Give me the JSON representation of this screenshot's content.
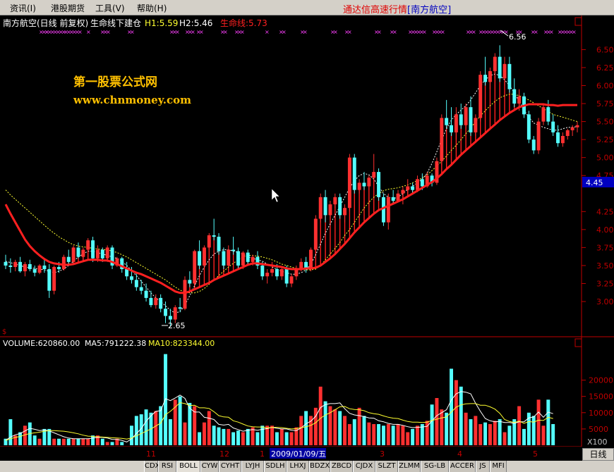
{
  "menu": [
    {
      "label": "资讯(I)"
    },
    {
      "label": "港股期货"
    },
    {
      "label": "工具(V)"
    },
    {
      "label": "帮助(H)"
    }
  ],
  "app_title": "通达信高速行情",
  "stock_tag": "[南方航空]",
  "header": {
    "stock": "南方航空(日线 前复权)",
    "indicator": "生命线下建仓",
    "h1_label": "H1:5.59",
    "h2_label": "H2:5.46",
    "life_label": "生命线:5.73"
  },
  "watermark": {
    "line1": "第一股票公式网",
    "line2": "www.chnmoney.com"
  },
  "price_axis": [
    "6.50",
    "6.25",
    "6.00",
    "5.75",
    "5.50",
    "5.25",
    "5.00",
    "4.75",
    "4.25",
    "4.00",
    "3.75",
    "3.50",
    "3.25",
    "3.00"
  ],
  "current_price": "4.45",
  "high_label": "6.56",
  "low_label": "2.65",
  "volume_header": {
    "vol": "VOLUME:620860.00",
    "ma5": "MA5:791222.38",
    "ma10": "MA10:823344.00"
  },
  "volume_axis": [
    "20000",
    "15000",
    "10000",
    "5000"
  ],
  "volume_unit": "X100",
  "date_axis": {
    "m11": "11",
    "m12": "12",
    "m1": "1",
    "selected_date": "2009/01/09/五",
    "m3": "3",
    "m4": "4",
    "m5": "5"
  },
  "period_button": "日线",
  "indicator_tabs": [
    "CDX",
    "RSI",
    "BOLL",
    "CYW",
    "CYHT",
    "LYJH",
    "SDLH",
    "LHXJ",
    "BDZX",
    "ZBCD",
    "CJDX",
    "SLZT",
    "ZLMM",
    "SG-LB",
    "ACCER",
    "JS",
    "MFI"
  ],
  "colors": {
    "up": "#ff3030",
    "down": "#54ffff",
    "lifeline": "#ff2020",
    "ma_white": "#ffffff",
    "ma_yellow": "#ffff30",
    "signal": "#ff40ff",
    "watermark": "#ffc000",
    "axis": "#c00000"
  },
  "chart_data": {
    "type": "candlestick",
    "y_range": [
      2.55,
      6.68
    ],
    "ohlc": [
      [
        3.55,
        3.65,
        3.45,
        3.5
      ],
      [
        3.5,
        3.6,
        3.4,
        3.48
      ],
      [
        3.48,
        3.58,
        3.42,
        3.55
      ],
      [
        3.55,
        3.62,
        3.4,
        3.42
      ],
      [
        3.42,
        3.55,
        3.35,
        3.52
      ],
      [
        3.52,
        3.58,
        3.42,
        3.45
      ],
      [
        3.45,
        3.5,
        3.35,
        3.4
      ],
      [
        3.4,
        3.52,
        3.38,
        3.5
      ],
      [
        3.5,
        3.6,
        3.4,
        3.45
      ],
      [
        3.45,
        3.52,
        3.05,
        3.15
      ],
      [
        3.15,
        3.5,
        3.1,
        3.48
      ],
      [
        3.48,
        3.55,
        3.4,
        3.45
      ],
      [
        3.45,
        3.65,
        3.43,
        3.62
      ],
      [
        3.62,
        3.72,
        3.52,
        3.55
      ],
      [
        3.55,
        3.78,
        3.52,
        3.75
      ],
      [
        3.75,
        3.82,
        3.6,
        3.62
      ],
      [
        3.62,
        3.75,
        3.55,
        3.72
      ],
      [
        3.72,
        3.88,
        3.6,
        3.85
      ],
      [
        3.85,
        3.9,
        3.55,
        3.6
      ],
      [
        3.6,
        3.78,
        3.55,
        3.72
      ],
      [
        3.72,
        3.75,
        3.55,
        3.6
      ],
      [
        3.6,
        3.78,
        3.55,
        3.75
      ],
      [
        3.75,
        3.78,
        3.45,
        3.5
      ],
      [
        3.5,
        3.62,
        3.48,
        3.6
      ],
      [
        3.6,
        3.62,
        3.4,
        3.45
      ],
      [
        3.45,
        3.55,
        3.3,
        3.35
      ],
      [
        3.35,
        3.48,
        3.25,
        3.3
      ],
      [
        3.3,
        3.4,
        3.15,
        3.2
      ],
      [
        3.2,
        3.3,
        3.1,
        3.15
      ],
      [
        3.15,
        3.25,
        3.0,
        3.05
      ],
      [
        3.05,
        3.15,
        2.92,
        2.95
      ],
      [
        2.95,
        3.1,
        2.9,
        3.05
      ],
      [
        3.05,
        3.1,
        2.85,
        2.9
      ],
      [
        2.9,
        3.0,
        2.7,
        2.8
      ],
      [
        2.8,
        2.9,
        2.65,
        2.75
      ],
      [
        2.75,
        2.95,
        2.7,
        2.92
      ],
      [
        2.92,
        3.05,
        2.85,
        2.9
      ],
      [
        2.9,
        3.35,
        2.88,
        3.3
      ],
      [
        3.3,
        3.42,
        3.2,
        3.25
      ],
      [
        3.25,
        3.72,
        3.22,
        3.7
      ],
      [
        3.7,
        3.85,
        3.45,
        3.5
      ],
      [
        3.5,
        3.78,
        3.48,
        3.75
      ],
      [
        3.75,
        3.95,
        3.72,
        3.92
      ],
      [
        3.92,
        4.15,
        3.85,
        3.9
      ],
      [
        3.9,
        3.95,
        3.65,
        3.7
      ],
      [
        3.7,
        3.75,
        3.45,
        3.5
      ],
      [
        3.5,
        3.78,
        3.48,
        3.72
      ],
      [
        3.72,
        3.9,
        3.65,
        3.7
      ],
      [
        3.7,
        3.75,
        3.45,
        3.5
      ],
      [
        3.5,
        3.7,
        3.45,
        3.68
      ],
      [
        3.68,
        3.72,
        3.5,
        3.55
      ],
      [
        3.55,
        3.65,
        3.5,
        3.62
      ],
      [
        3.62,
        3.7,
        3.45,
        3.5
      ],
      [
        3.5,
        3.55,
        3.3,
        3.35
      ],
      [
        3.35,
        3.45,
        3.25,
        3.4
      ],
      [
        3.4,
        3.55,
        3.35,
        3.45
      ],
      [
        3.45,
        3.52,
        3.3,
        3.35
      ],
      [
        3.35,
        3.48,
        3.3,
        3.45
      ],
      [
        3.45,
        3.5,
        3.2,
        3.25
      ],
      [
        3.25,
        3.38,
        3.2,
        3.35
      ],
      [
        3.35,
        3.5,
        3.3,
        3.45
      ],
      [
        3.45,
        3.6,
        3.42,
        3.55
      ],
      [
        3.55,
        3.62,
        3.4,
        3.45
      ],
      [
        3.45,
        3.75,
        3.42,
        3.72
      ],
      [
        3.72,
        4.2,
        3.7,
        4.15
      ],
      [
        4.15,
        4.5,
        4.1,
        4.45
      ],
      [
        4.45,
        4.55,
        4.1,
        4.2
      ],
      [
        4.2,
        4.4,
        4.15,
        4.35
      ],
      [
        4.35,
        4.5,
        4.3,
        4.45
      ],
      [
        4.45,
        4.5,
        4.15,
        4.2
      ],
      [
        4.2,
        4.35,
        4.1,
        4.3
      ],
      [
        4.3,
        5.05,
        4.25,
        5.0
      ],
      [
        5.0,
        5.05,
        4.5,
        4.55
      ],
      [
        4.55,
        4.7,
        4.5,
        4.65
      ],
      [
        4.65,
        4.8,
        4.55,
        4.6
      ],
      [
        4.6,
        4.75,
        4.55,
        4.72
      ],
      [
        4.72,
        5.05,
        4.7,
        4.8
      ],
      [
        4.8,
        4.85,
        4.4,
        4.45
      ],
      [
        4.45,
        4.5,
        4.05,
        4.1
      ],
      [
        4.1,
        4.5,
        4.0,
        4.45
      ],
      [
        4.45,
        4.55,
        4.35,
        4.4
      ],
      [
        4.4,
        4.55,
        4.38,
        4.5
      ],
      [
        4.5,
        4.6,
        4.35,
        4.55
      ],
      [
        4.55,
        4.7,
        4.5,
        4.6
      ],
      [
        4.6,
        4.65,
        4.5,
        4.55
      ],
      [
        4.55,
        4.75,
        4.52,
        4.7
      ],
      [
        4.7,
        4.78,
        4.55,
        4.6
      ],
      [
        4.6,
        4.8,
        4.58,
        4.75
      ],
      [
        4.75,
        4.78,
        4.6,
        4.65
      ],
      [
        4.65,
        5.0,
        4.62,
        4.95
      ],
      [
        4.95,
        5.6,
        4.9,
        5.55
      ],
      [
        5.55,
        5.8,
        5.4,
        5.45
      ],
      [
        5.45,
        5.7,
        5.3,
        5.35
      ],
      [
        5.35,
        5.7,
        5.25,
        5.6
      ],
      [
        5.6,
        5.75,
        5.4,
        5.45
      ],
      [
        5.45,
        5.75,
        5.4,
        5.7
      ],
      [
        5.7,
        5.85,
        5.3,
        5.35
      ],
      [
        5.35,
        5.6,
        5.3,
        5.55
      ],
      [
        5.55,
        6.2,
        5.5,
        6.15
      ],
      [
        6.15,
        6.4,
        6.0,
        6.05
      ],
      [
        6.05,
        6.25,
        5.95,
        6.2
      ],
      [
        6.2,
        6.45,
        6.1,
        6.4
      ],
      [
        6.4,
        6.56,
        6.05,
        6.1
      ],
      [
        6.1,
        6.4,
        6.0,
        6.3
      ],
      [
        6.3,
        6.4,
        5.9,
        5.95
      ],
      [
        5.95,
        6.1,
        5.7,
        5.75
      ],
      [
        5.75,
        5.95,
        5.65,
        5.85
      ],
      [
        5.85,
        5.9,
        5.55,
        5.6
      ],
      [
        5.6,
        5.65,
        5.2,
        5.25
      ],
      [
        5.25,
        5.3,
        5.05,
        5.1
      ],
      [
        5.1,
        5.55,
        5.05,
        5.5
      ],
      [
        5.5,
        5.75,
        5.45,
        5.7
      ],
      [
        5.7,
        5.8,
        5.45,
        5.5
      ],
      [
        5.5,
        5.6,
        5.3,
        5.35
      ],
      [
        5.35,
        5.45,
        5.15,
        5.2
      ],
      [
        5.2,
        5.35,
        5.15,
        5.3
      ],
      [
        5.3,
        5.4,
        5.25,
        5.38
      ],
      [
        5.38,
        5.45,
        5.3,
        5.42
      ],
      [
        5.42,
        5.5,
        5.35,
        5.45
      ]
    ],
    "volume": [
      2000,
      8000,
      3000,
      4000,
      6000,
      7000,
      3000,
      2000,
      5000,
      5000,
      2000,
      2000,
      2000,
      2000,
      2000,
      2000,
      2000,
      2000,
      3000,
      3000,
      2000,
      1000,
      1000,
      2000,
      1000,
      0,
      6000,
      9000,
      9500,
      11000,
      10000,
      10500,
      12000,
      28000,
      8000,
      14000,
      15000,
      7000,
      13000,
      12000,
      4000,
      7000,
      10500,
      6000,
      5500,
      5000,
      5000,
      4000,
      4500,
      4000,
      5000,
      5500,
      4000,
      6000,
      6000,
      6000,
      4000,
      5000,
      4000,
      4000,
      5500,
      9000,
      10500,
      9000,
      11500,
      18000,
      13500,
      12000,
      11000,
      10500,
      9000,
      6500,
      8000,
      11500,
      9000,
      7000,
      6500,
      6500,
      6000,
      6500,
      6000,
      6500,
      6000,
      4000,
      5000,
      6000,
      6500,
      7500,
      12500,
      14500,
      11000,
      10000,
      23500,
      20000,
      18000,
      10000,
      8000,
      9000,
      6500,
      7000,
      6500,
      7500,
      8000,
      4000,
      6000,
      8000,
      12000,
      5000,
      10000,
      9000,
      14000,
      6000,
      14000,
      6500
    ],
    "lifeline": [
      4.35,
      4.22,
      4.1,
      3.98,
      3.86,
      3.77,
      3.7,
      3.64,
      3.59,
      3.55,
      3.53,
      3.52,
      3.51,
      3.51,
      3.52,
      3.54,
      3.56,
      3.58,
      3.58,
      3.58,
      3.57,
      3.57,
      3.55,
      3.52,
      3.49,
      3.46,
      3.43,
      3.4,
      3.38,
      3.35,
      3.32,
      3.29,
      3.26,
      3.22,
      3.18,
      3.14,
      3.12,
      3.12,
      3.14,
      3.17,
      3.2,
      3.23,
      3.26,
      3.3,
      3.33,
      3.36,
      3.39,
      3.42,
      3.45,
      3.48,
      3.51,
      3.53,
      3.53,
      3.52,
      3.51,
      3.5,
      3.49,
      3.48,
      3.46,
      3.45,
      3.45,
      3.45,
      3.46,
      3.46,
      3.47,
      3.5,
      3.55,
      3.6,
      3.66,
      3.73,
      3.8,
      3.88,
      3.96,
      4.03,
      4.1,
      4.16,
      4.22,
      4.27,
      4.3,
      4.33,
      4.36,
      4.39,
      4.42,
      4.46,
      4.5,
      4.54,
      4.58,
      4.62,
      4.66,
      4.71,
      4.77,
      4.84,
      4.9,
      4.97,
      5.04,
      5.1,
      5.16,
      5.22,
      5.28,
      5.34,
      5.4,
      5.46,
      5.52,
      5.57,
      5.62,
      5.66,
      5.7,
      5.72,
      5.74,
      5.74,
      5.74,
      5.74,
      5.73,
      5.73,
      5.72,
      5.73,
      5.73,
      5.73,
      5.73
    ],
    "ma_yellow": [
      4.55,
      4.48,
      4.42,
      4.36,
      4.3,
      4.24,
      4.18,
      4.12,
      4.06,
      4.0,
      3.95,
      3.9,
      3.86,
      3.82,
      3.79,
      3.77,
      3.76,
      3.75,
      3.74,
      3.73,
      3.72,
      3.72,
      3.7,
      3.68,
      3.65,
      3.62,
      3.58,
      3.54,
      3.5,
      3.46,
      3.42,
      3.38,
      3.34,
      3.3,
      3.25,
      3.2,
      3.16,
      3.13,
      3.12,
      3.12,
      3.14,
      3.18,
      3.24,
      3.3,
      3.36,
      3.42,
      3.48,
      3.53,
      3.58,
      3.62,
      3.64,
      3.64,
      3.63,
      3.62,
      3.6,
      3.58,
      3.55,
      3.52,
      3.5,
      3.48,
      3.46,
      3.45,
      3.44,
      3.44,
      3.45,
      3.5,
      3.58,
      3.66,
      3.74,
      3.82,
      3.92,
      4.0,
      4.1,
      4.2,
      4.3,
      4.38,
      4.45,
      4.5,
      4.54,
      4.56,
      4.57,
      4.58,
      4.6,
      4.62,
      4.65,
      4.68,
      4.72,
      4.76,
      4.82,
      4.88,
      4.95,
      5.02,
      5.1,
      5.17,
      5.25,
      5.33,
      5.41,
      5.5,
      5.58,
      5.65,
      5.72,
      5.78,
      5.83,
      5.86,
      5.88,
      5.88,
      5.86,
      5.83,
      5.8,
      5.76,
      5.72,
      5.68,
      5.64,
      5.6,
      5.58,
      5.56,
      5.54,
      5.52,
      5.5
    ],
    "ma_white": [
      3.56,
      3.54,
      3.52,
      3.5,
      3.48,
      3.47,
      3.46,
      3.45,
      3.44,
      3.42,
      3.4,
      3.42,
      3.45,
      3.5,
      3.56,
      3.62,
      3.66,
      3.7,
      3.7,
      3.68,
      3.66,
      3.64,
      3.62,
      3.6,
      3.56,
      3.5,
      3.43,
      3.36,
      3.28,
      3.2,
      3.12,
      3.05,
      3.0,
      2.94,
      2.88,
      2.84,
      2.86,
      2.95,
      3.08,
      3.22,
      3.36,
      3.48,
      3.58,
      3.66,
      3.7,
      3.72,
      3.72,
      3.7,
      3.68,
      3.66,
      3.62,
      3.6,
      3.58,
      3.56,
      3.52,
      3.48,
      3.45,
      3.42,
      3.4,
      3.38,
      3.38,
      3.4,
      3.44,
      3.52,
      3.65,
      3.8,
      3.95,
      4.08,
      4.2,
      4.32,
      4.45,
      4.58,
      4.68,
      4.75,
      4.78,
      4.76,
      4.7,
      4.6,
      4.5,
      4.45,
      4.43,
      4.45,
      4.5,
      4.56,
      4.6,
      4.65,
      4.7,
      4.78,
      4.92,
      5.08,
      5.25,
      5.4,
      5.52,
      5.6,
      5.66,
      5.72,
      5.8,
      5.9,
      6.0,
      6.08,
      6.14,
      6.16,
      6.14,
      6.08,
      6.0,
      5.9,
      5.78,
      5.66,
      5.56,
      5.48,
      5.45,
      5.42,
      5.4,
      5.38,
      5.38,
      5.4,
      5.42,
      5.42,
      5.43
    ],
    "vol_ma5": [
      1500,
      2500,
      3200,
      3600,
      4400,
      5200,
      4900,
      4500,
      4700,
      4400,
      3800,
      3200,
      2600,
      2200,
      2000,
      2000,
      2000,
      2000,
      2200,
      2400,
      2400,
      2200,
      1800,
      1800,
      1500,
      1000,
      2000,
      3600,
      5100,
      7400,
      9000,
      10400,
      10600,
      14300,
      13700,
      14500,
      15400,
      14400,
      11400,
      10200,
      10200,
      8600,
      8300,
      7900,
      6400,
      6200,
      6400,
      5300,
      4800,
      4300,
      4600,
      4800,
      4600,
      4900,
      5100,
      5500,
      5200,
      5000,
      5000,
      4600,
      4500,
      5300,
      6600,
      7400,
      8900,
      11600,
      12500,
      12800,
      12800,
      13000,
      11200,
      9800,
      9300,
      9100,
      8800,
      8400,
      8300,
      7500,
      7200,
      6700,
      6400,
      6400,
      6100,
      5700,
      5400,
      5500,
      5600,
      5800,
      7500,
      9100,
      10000,
      10900,
      13900,
      15800,
      16500,
      16300,
      15800,
      12900,
      10400,
      8200,
      7500,
      7200,
      7300,
      7000,
      7000,
      6700,
      7200,
      7200,
      8400,
      8700,
      10200,
      8600,
      10200,
      9700
    ],
    "vol_ma10": [
      1500,
      2000,
      2400,
      2700,
      3200,
      3600,
      3800,
      4000,
      4300,
      4500,
      4500,
      4400,
      4300,
      4100,
      3800,
      3500,
      3100,
      2800,
      2700,
      2600,
      2500,
      2400,
      2300,
      2200,
      2100,
      1900,
      2200,
      2900,
      3600,
      4300,
      5000,
      5900,
      6800,
      9400,
      10400,
      11700,
      13100,
      12800,
      12200,
      12300,
      11500,
      11500,
      11300,
      10300,
      9100,
      8700,
      8600,
      7500,
      7100,
      6500,
      5900,
      5700,
      5600,
      5600,
      5300,
      5500,
      5500,
      5400,
      5200,
      5000,
      5100,
      5400,
      5700,
      6100,
      6900,
      8300,
      9300,
      10000,
      10900,
      11800,
      11900,
      11200,
      11000,
      10900,
      10600,
      10000,
      9700,
      9500,
      9000,
      8600,
      8300,
      8200,
      7700,
      7300,
      7100,
      7100,
      7000,
      7100,
      7600,
      8000,
      8400,
      8700,
      10200,
      11700,
      12400,
      12700,
      12800,
      12800,
      12300,
      12300,
      11800,
      11100,
      9800,
      7900,
      7300,
      7000,
      7400,
      6700,
      7300,
      7100,
      7700,
      7600,
      8600,
      8200
    ],
    "signals_ranges": [
      [
        55,
        63
      ],
      [
        63,
        88
      ],
      [
        90,
        110
      ],
      [
        122,
        125
      ],
      [
        142,
        150
      ],
      [
        180,
        185
      ],
      [
        240,
        248
      ],
      [
        262,
        270
      ],
      [
        278,
        283
      ],
      [
        312,
        318
      ],
      [
        332,
        340
      ],
      [
        375,
        378
      ],
      [
        395,
        402
      ],
      [
        425,
        430
      ],
      [
        468,
        472
      ],
      [
        488,
        492
      ],
      [
        530,
        534
      ],
      [
        552,
        556
      ],
      [
        578,
        598
      ],
      [
        612,
        625
      ],
      [
        660,
        668
      ],
      [
        678,
        715
      ],
      [
        730,
        735
      ],
      [
        752,
        756
      ],
      [
        770,
        778
      ],
      [
        790,
        812
      ]
    ]
  }
}
